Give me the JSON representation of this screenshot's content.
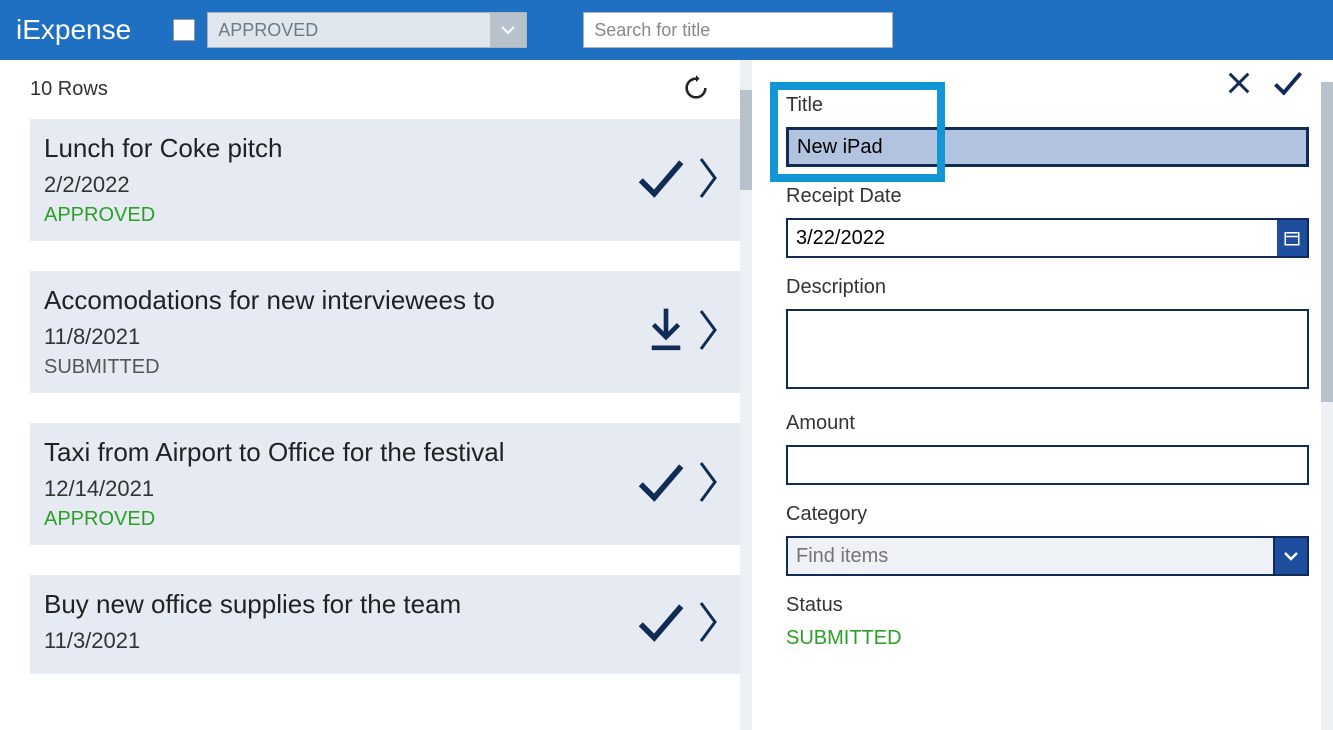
{
  "header": {
    "app_title": "iExpense",
    "status_filter": "APPROVED",
    "search_placeholder": "Search for title"
  },
  "list": {
    "row_count_label": "10 Rows",
    "items": [
      {
        "title": "Lunch for Coke pitch",
        "date": "2/2/2022",
        "status": "APPROVED",
        "status_class": "status-approved",
        "action_icon": "check"
      },
      {
        "title": "Accomodations for new interviewees to",
        "date": "11/8/2021",
        "status": "SUBMITTED",
        "status_class": "status-submitted",
        "action_icon": "download"
      },
      {
        "title": "Taxi from Airport to Office for the festival",
        "date": "12/14/2021",
        "status": "APPROVED",
        "status_class": "status-approved",
        "action_icon": "check"
      },
      {
        "title": "Buy new office supplies for the team",
        "date": "11/3/2021",
        "status": "",
        "status_class": "",
        "action_icon": "check"
      }
    ]
  },
  "form": {
    "title_label": "Title",
    "title_value": "New iPad",
    "receipt_date_label": "Receipt Date",
    "receipt_date_value": "3/22/2022",
    "description_label": "Description",
    "description_value": "",
    "amount_label": "Amount",
    "amount_value": "",
    "category_label": "Category",
    "category_placeholder": "Find items",
    "status_label": "Status",
    "status_value": "SUBMITTED"
  }
}
